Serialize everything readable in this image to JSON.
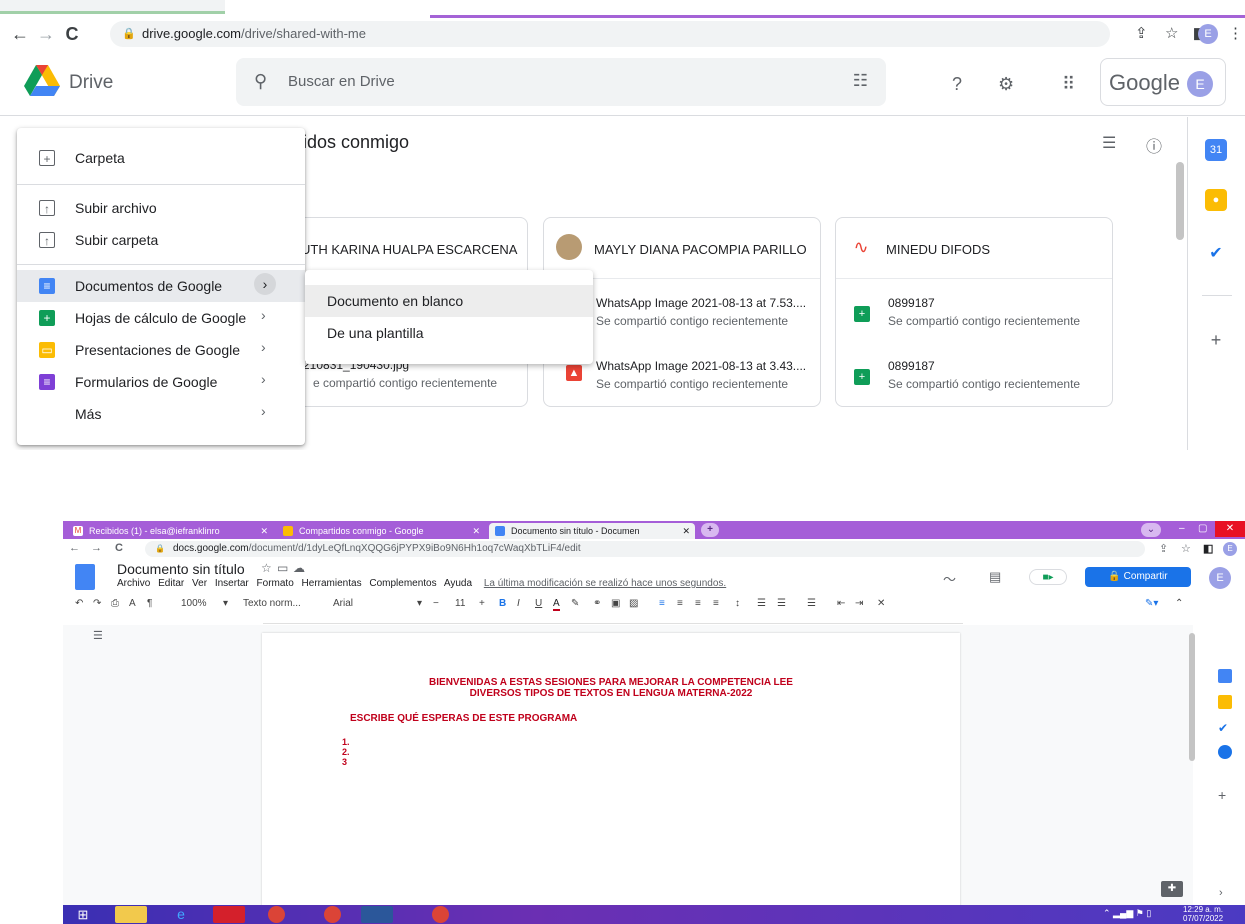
{
  "top": {
    "url_host": "drive.google.com",
    "url_path": "/drive/shared-with-me",
    "app_name": "Drive",
    "search_placeholder": "Buscar en Drive",
    "google_word": "Google",
    "avatar_letter": "E",
    "page_title": "tidos conmigo",
    "menu": {
      "items": [
        {
          "label": "Carpeta"
        },
        {
          "label": "Subir archivo"
        },
        {
          "label": "Subir carpeta"
        },
        {
          "label": "Documentos de Google"
        },
        {
          "label": "Hojas de cálculo de Google"
        },
        {
          "label": "Presentaciones de Google"
        },
        {
          "label": "Formularios de Google"
        },
        {
          "label": "Más"
        }
      ]
    },
    "submenu": {
      "items": [
        {
          "label": "Documento en blanco"
        },
        {
          "label": "De una plantilla"
        }
      ]
    },
    "cards": [
      {
        "owner": "UTH KARINA HUALPA ESCARCENA",
        "files": [
          {
            "name": "",
            "sub": ""
          },
          {
            "name": "210831_190430.jpg",
            "sub": "e compartió contigo recientemente"
          }
        ]
      },
      {
        "owner": "MAYLY DIANA PACOMPIA PARILLO",
        "files": [
          {
            "name": "WhatsApp Image 2021-08-13 at 7.53....",
            "sub": "Se compartió contigo recientemente"
          },
          {
            "name": "WhatsApp Image 2021-08-13 at 3.43....",
            "sub": "Se compartió contigo recientemente"
          }
        ]
      },
      {
        "owner": "MINEDU DIFODS",
        "files": [
          {
            "name": "0899187",
            "sub": "Se compartió contigo recientemente"
          },
          {
            "name": "0899187",
            "sub": "Se compartió contigo recientemente"
          }
        ]
      }
    ]
  },
  "bottom": {
    "tabs": [
      {
        "label": "Recibidos (1) - elsa@iefranklinro"
      },
      {
        "label": "Compartidos conmigo - Google"
      },
      {
        "label": "Documento sin título - Documen"
      }
    ],
    "new_tab_glyph": "+",
    "url_host": "docs.google.com",
    "url_path": "/document/d/1dyLeQfLnqXQQG6jPYPX9iBo9N6Hh1oq7cWaqXbTLiF4/edit",
    "doc_title": "Documento sin título",
    "menus": [
      "Archivo",
      "Editar",
      "Ver",
      "Insertar",
      "Formato",
      "Herramientas",
      "Complementos",
      "Ayuda"
    ],
    "last_edit": "La última modificación se realizó hace unos segundos.",
    "share_label": "Compartir",
    "avatar_letter": "E",
    "toolbar": {
      "zoom": "100%",
      "style": "Texto norm...",
      "font": "Arial",
      "size": "11"
    },
    "doc_body": {
      "heading_line1": "BIENVENIDAS  A  ESTAS SESIONES PARA MEJORAR LA COMPETENCIA LEE",
      "heading_line2": "DIVERSOS TIPOS DE TEXTOS EN LENGUA MATERNA-2022",
      "subheading": "ESCRIBE QUÉ ESPERAS DE ESTE PROGRAMA",
      "list": [
        "1.",
        "2.",
        "3"
      ]
    },
    "clock_time": "12:29 a. m.",
    "clock_date": "07/07/2022"
  }
}
